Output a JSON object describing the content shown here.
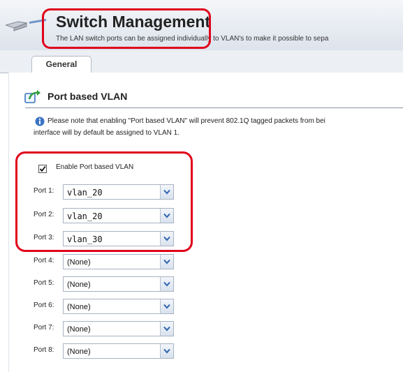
{
  "header": {
    "title": "Switch Management",
    "subtitle": "The LAN switch ports can be assigned individually to VLAN's to make it possible to sepa"
  },
  "tabs": [
    {
      "label": "General",
      "active": true
    }
  ],
  "section": {
    "title": "Port based VLAN",
    "note_line1": "Please note that enabling \"Port based VLAN\" will prevent 802.1Q tagged packets from bei",
    "note_line2": "interface will by default be assigned to VLAN 1."
  },
  "enable_checkbox": {
    "label": "Enable Port based VLAN",
    "checked": true
  },
  "ports": [
    {
      "label": "Port 1:",
      "value": "vlan_20"
    },
    {
      "label": "Port 2:",
      "value": "vlan_20"
    },
    {
      "label": "Port 3:",
      "value": "vlan_30"
    },
    {
      "label": "Port 4:",
      "value": "(None)"
    },
    {
      "label": "Port 5:",
      "value": "(None)"
    },
    {
      "label": "Port 6:",
      "value": "(None)"
    },
    {
      "label": "Port 7:",
      "value": "(None)"
    },
    {
      "label": "Port 8:",
      "value": "(None)"
    }
  ],
  "colors": {
    "highlight": "#e0001b",
    "header_bg": "#dde3ec",
    "accent_blue": "#3a73c4"
  },
  "icons": [
    "switch-icon",
    "vlan-icon",
    "info-icon",
    "chevron-down-icon"
  ]
}
